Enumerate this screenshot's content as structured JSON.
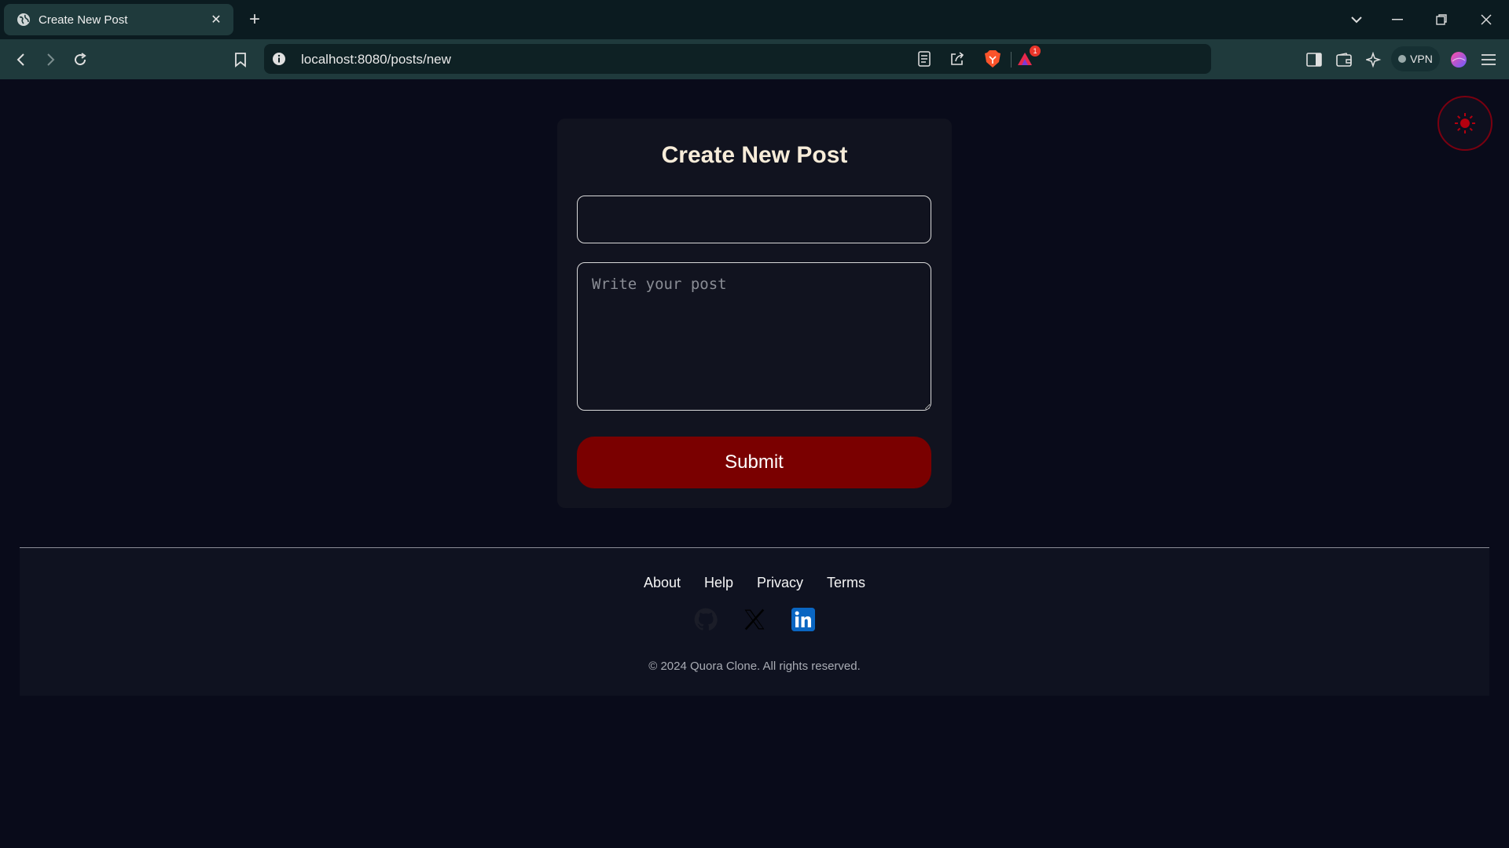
{
  "browser": {
    "tab_title": "Create New Post",
    "url": "localhost:8080/posts/new",
    "vpn_label": "VPN",
    "notification_count": "1"
  },
  "page": {
    "heading": "Create New Post",
    "title_input": {
      "value": "",
      "placeholder": ""
    },
    "body_input": {
      "value": "",
      "placeholder": "Write your post"
    },
    "submit_label": "Submit"
  },
  "footer": {
    "links": [
      "About",
      "Help",
      "Privacy",
      "Terms"
    ],
    "socials": [
      "github-icon",
      "x-icon",
      "linkedin-icon"
    ],
    "copyright": "© 2024 Quora Clone. All rights reserved."
  },
  "colors": {
    "page_bg": "#090b1a",
    "card_bg": "#11131f",
    "submit_bg": "#7a0000",
    "heading": "#f7ecd9",
    "toolbar": "#1f3a3c"
  }
}
